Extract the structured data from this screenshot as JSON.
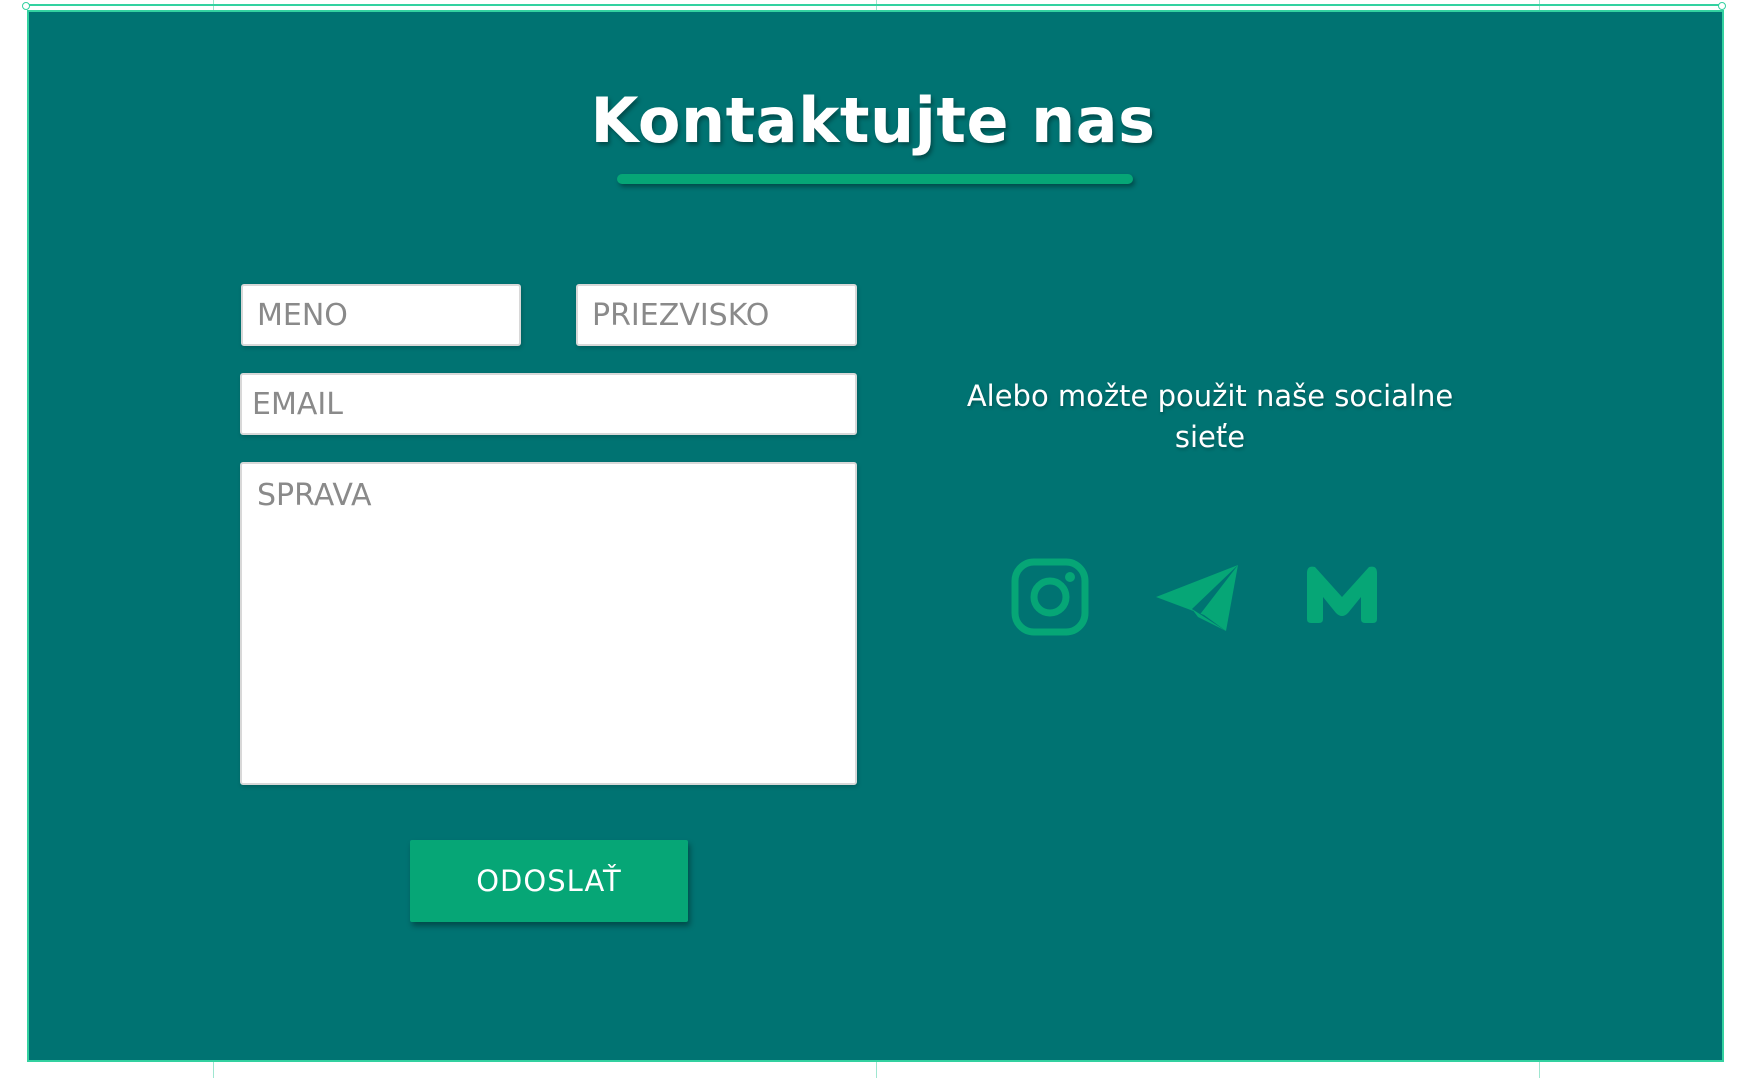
{
  "contact": {
    "title": "Kontaktujte nas"
  },
  "form": {
    "first_name_placeholder": "MENO",
    "last_name_placeholder": "PRIEZVISKO",
    "email_placeholder": "EMAIL",
    "message_placeholder": "SPRAVA",
    "submit_label": "ODOSLAŤ"
  },
  "social": {
    "text": "Alebo možte použit naše socialne sieťe",
    "icons": [
      "instagram-icon",
      "telegram-icon",
      "medium-icon"
    ]
  },
  "colors": {
    "background": "#007372",
    "accent": "#06a676",
    "guides": "#33d1a0"
  }
}
